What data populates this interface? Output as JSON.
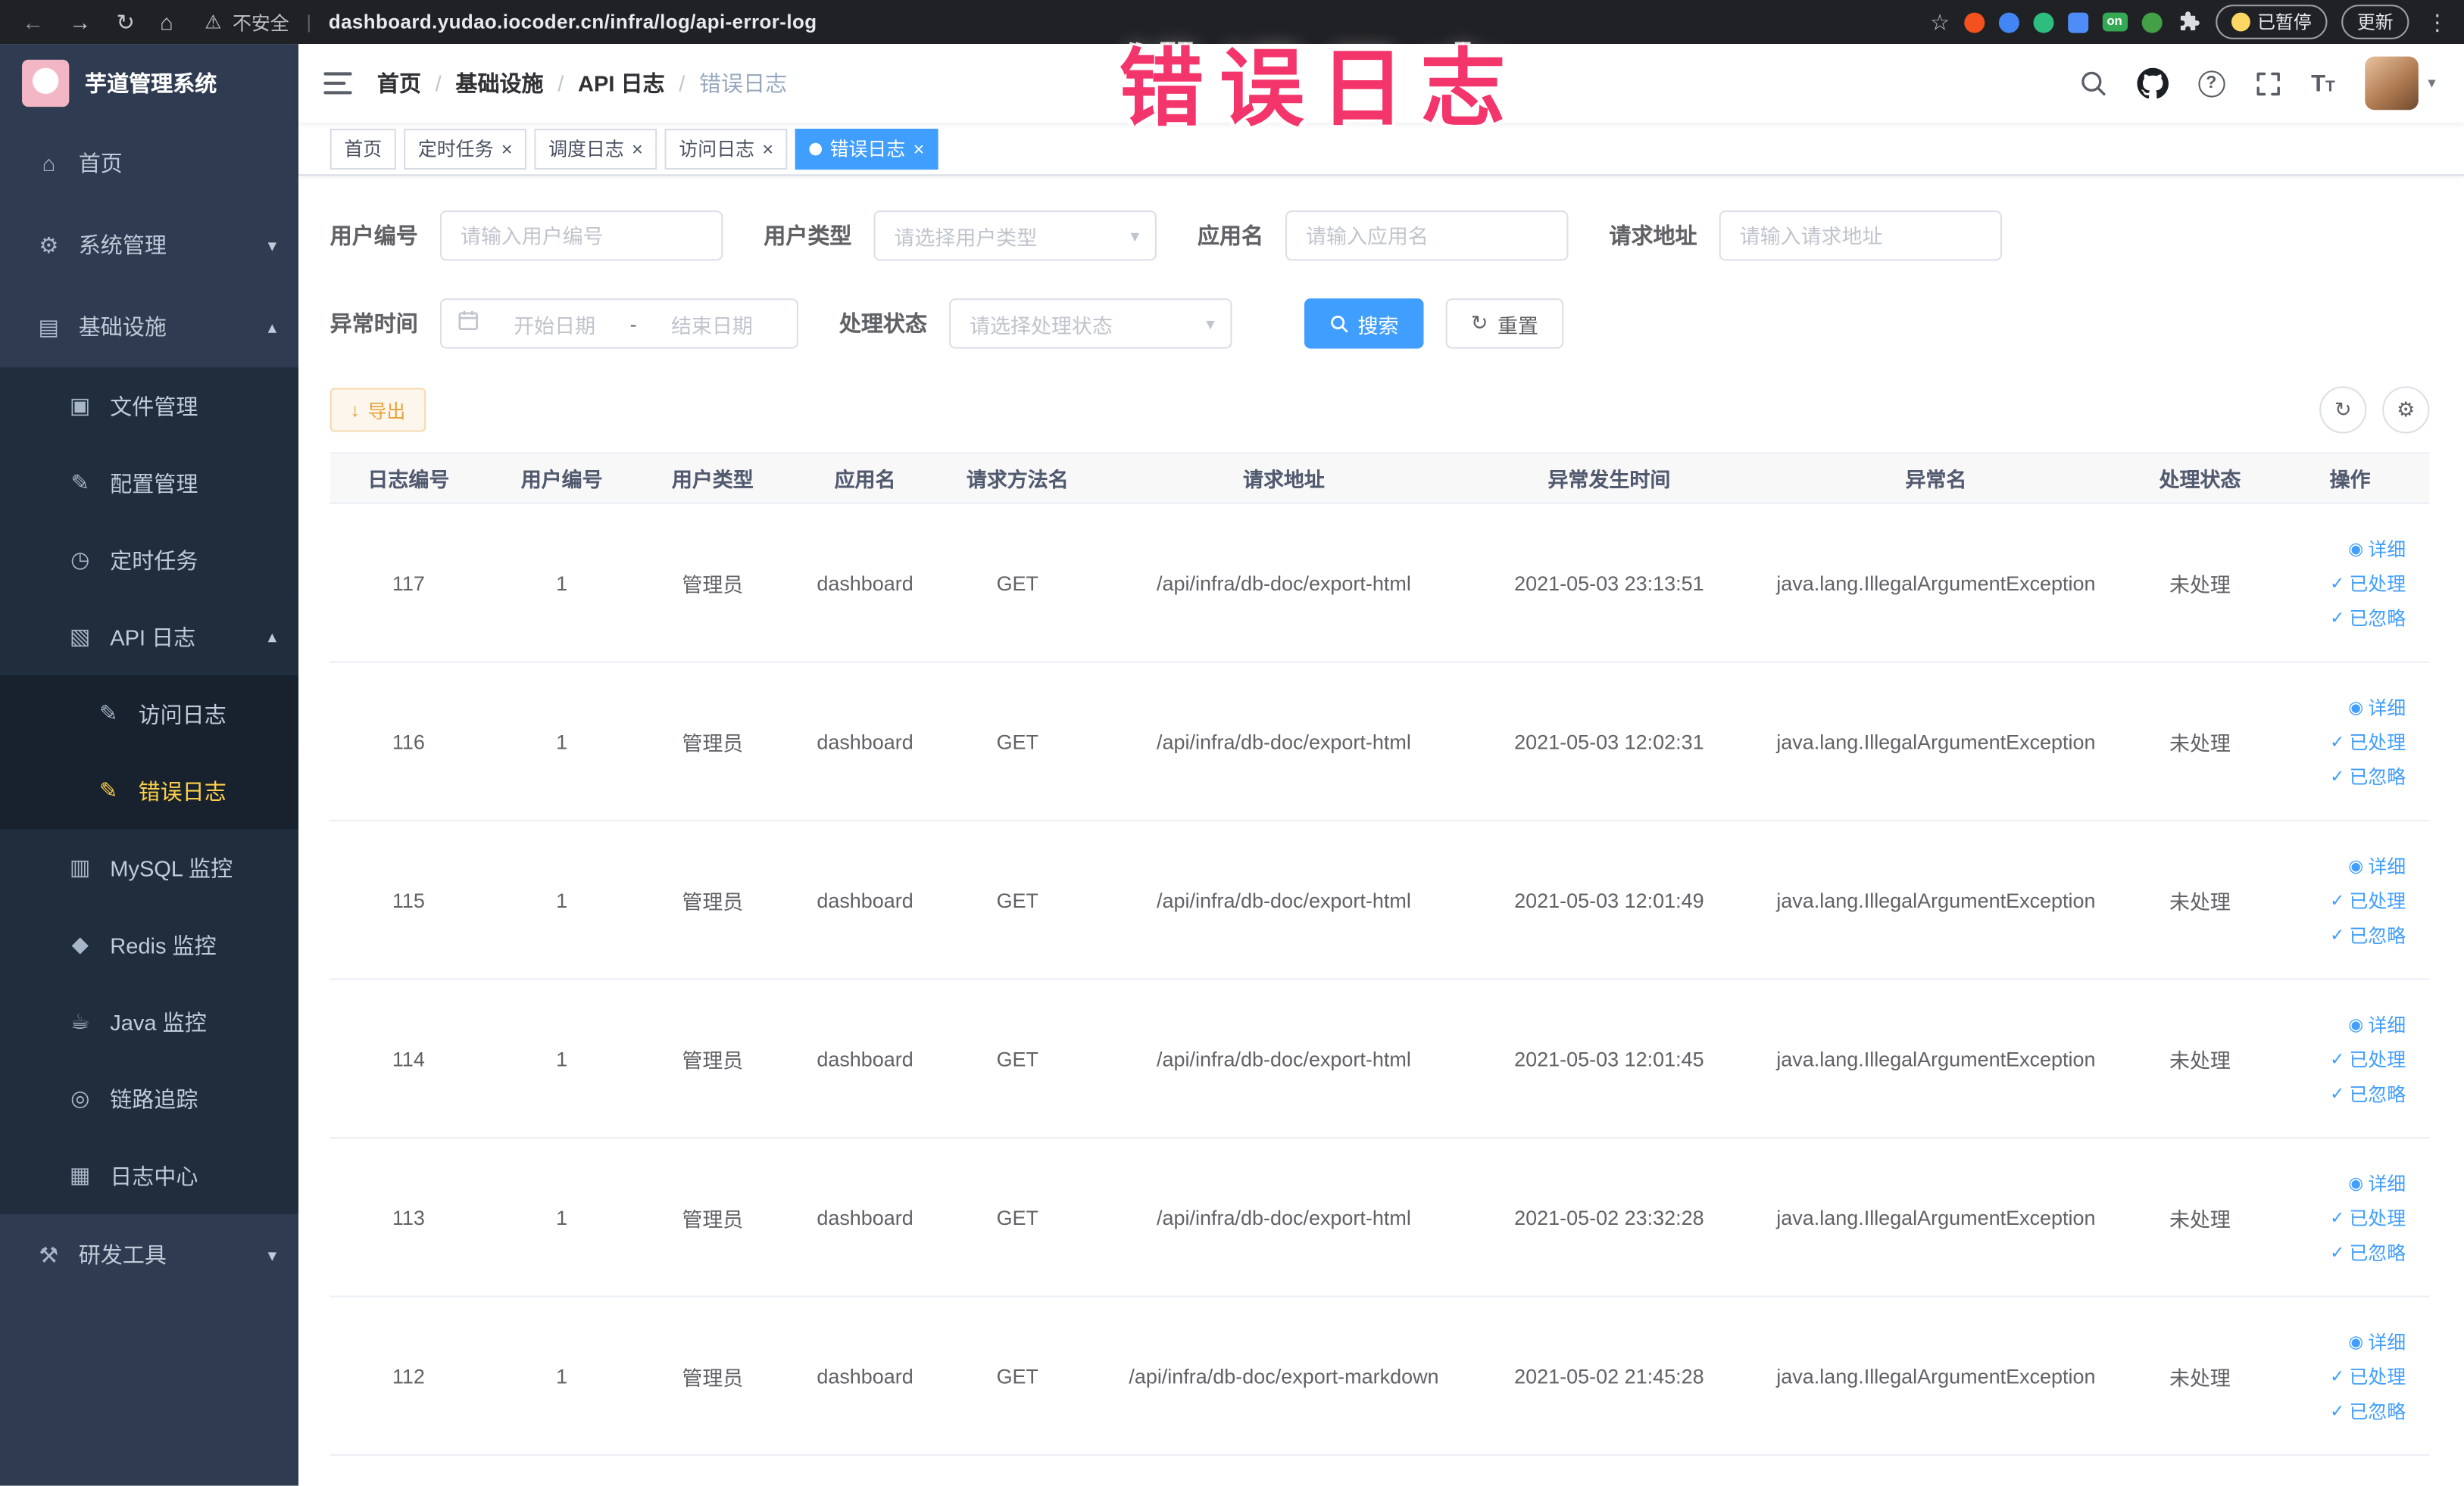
{
  "browser": {
    "security_label": "不安全",
    "url": "dashboard.yudao.iocoder.cn/infra/log/api-error-log",
    "ext_on_badge": "on",
    "paused_badge": "已暂停",
    "update_button": "更新"
  },
  "annotation": {
    "text": "错误日志"
  },
  "colors": {
    "accent": "#409eff",
    "sidebar_bg": "#2e3b50",
    "submenu_bg": "#1f2d3d",
    "menu_active_text": "#ffd04b",
    "warning_text": "#e6a23c",
    "annotation_text": "#f4356b"
  },
  "sidebar": {
    "logo_title": "芋道管理系统",
    "items": [
      {
        "label": "首页",
        "level": 1,
        "icon": "home-icon",
        "glyph": "⌂"
      },
      {
        "label": "系统管理",
        "level": 1,
        "icon": "gear-icon",
        "glyph": "⚙",
        "chevron": "down"
      },
      {
        "label": "基础设施",
        "level": 1,
        "icon": "infrastructure-icon",
        "glyph": "▤",
        "chevron": "up"
      },
      {
        "label": "文件管理",
        "level": 2,
        "icon": "file-icon",
        "glyph": "▣"
      },
      {
        "label": "配置管理",
        "level": 2,
        "icon": "config-icon",
        "glyph": "✎"
      },
      {
        "label": "定时任务",
        "level": 2,
        "icon": "schedule-icon",
        "glyph": "◷"
      },
      {
        "label": "API 日志",
        "level": 2,
        "icon": "api-log-icon",
        "glyph": "▧",
        "chevron": "up"
      },
      {
        "label": "访问日志",
        "level": 3,
        "icon": "access-log-icon",
        "glyph": "✎"
      },
      {
        "label": "错误日志",
        "level": 3,
        "icon": "error-log-icon",
        "glyph": "✎",
        "active": true
      },
      {
        "label": "MySQL 监控",
        "level": 2,
        "icon": "mysql-icon",
        "glyph": "▥"
      },
      {
        "label": "Redis 监控",
        "level": 2,
        "icon": "redis-icon",
        "glyph": "◆"
      },
      {
        "label": "Java 监控",
        "level": 2,
        "icon": "java-icon",
        "glyph": "☕"
      },
      {
        "label": "链路追踪",
        "level": 2,
        "icon": "trace-icon",
        "glyph": "◎"
      },
      {
        "label": "日志中心",
        "level": 2,
        "icon": "log-center-icon",
        "glyph": "▦"
      },
      {
        "label": "研发工具",
        "level": 1,
        "icon": "tools-icon",
        "glyph": "⚒",
        "chevron": "down"
      }
    ]
  },
  "header": {
    "breadcrumb": [
      "首页",
      "基础设施",
      "API 日志",
      "错误日志"
    ],
    "separator": "/"
  },
  "tabs": {
    "close_glyph": "×",
    "items": [
      {
        "label": "首页",
        "closable": false,
        "active": false
      },
      {
        "label": "定时任务",
        "closable": true,
        "active": false
      },
      {
        "label": "调度日志",
        "closable": true,
        "active": false
      },
      {
        "label": "访问日志",
        "closable": true,
        "active": false
      },
      {
        "label": "错误日志",
        "closable": true,
        "active": true
      }
    ]
  },
  "filters": {
    "user_id": {
      "label": "用户编号",
      "placeholder": "请输入用户编号"
    },
    "user_type": {
      "label": "用户类型",
      "placeholder": "请选择用户类型"
    },
    "app_name": {
      "label": "应用名",
      "placeholder": "请输入应用名"
    },
    "request_url": {
      "label": "请求地址",
      "placeholder": "请输入请求地址"
    },
    "exception_time": {
      "label": "异常时间",
      "start_placeholder": "开始日期",
      "end_placeholder": "结束日期",
      "separator": "-"
    },
    "process_status": {
      "label": "处理状态",
      "placeholder": "请选择处理状态"
    },
    "search_button": "搜索",
    "reset_button": "重置"
  },
  "toolbar": {
    "export_button": "导出"
  },
  "table": {
    "columns": [
      "日志编号",
      "用户编号",
      "用户类型",
      "应用名",
      "请求方法名",
      "请求地址",
      "异常发生时间",
      "异常名",
      "处理状态",
      "操作"
    ],
    "action_labels": [
      {
        "label": "详细",
        "icon": "eye"
      },
      {
        "label": "已处理",
        "icon": "check"
      },
      {
        "label": "已忽略",
        "icon": "check"
      }
    ],
    "rows": [
      {
        "id": "117",
        "user_id": "1",
        "user_type": "管理员",
        "app": "dashboard",
        "method": "GET",
        "url": "/api/infra/db-doc/export-html",
        "time": "2021-05-03 23:13:51",
        "exception": "java.lang.IllegalArgumentException",
        "status": "未处理"
      },
      {
        "id": "116",
        "user_id": "1",
        "user_type": "管理员",
        "app": "dashboard",
        "method": "GET",
        "url": "/api/infra/db-doc/export-html",
        "time": "2021-05-03 12:02:31",
        "exception": "java.lang.IllegalArgumentException",
        "status": "未处理"
      },
      {
        "id": "115",
        "user_id": "1",
        "user_type": "管理员",
        "app": "dashboard",
        "method": "GET",
        "url": "/api/infra/db-doc/export-html",
        "time": "2021-05-03 12:01:49",
        "exception": "java.lang.IllegalArgumentException",
        "status": "未处理"
      },
      {
        "id": "114",
        "user_id": "1",
        "user_type": "管理员",
        "app": "dashboard",
        "method": "GET",
        "url": "/api/infra/db-doc/export-html",
        "time": "2021-05-03 12:01:45",
        "exception": "java.lang.IllegalArgumentException",
        "status": "未处理"
      },
      {
        "id": "113",
        "user_id": "1",
        "user_type": "管理员",
        "app": "dashboard",
        "method": "GET",
        "url": "/api/infra/db-doc/export-html",
        "time": "2021-05-02 23:32:28",
        "exception": "java.lang.IllegalArgumentException",
        "status": "未处理"
      },
      {
        "id": "112",
        "user_id": "1",
        "user_type": "管理员",
        "app": "dashboard",
        "method": "GET",
        "url": "/api/infra/db-doc/export-markdown",
        "time": "2021-05-02 21:45:28",
        "exception": "java.lang.IllegalArgumentException",
        "status": "未处理"
      }
    ]
  },
  "glyphs": {
    "back": "←",
    "forward": "→",
    "reload": "↻",
    "home": "⌂",
    "warning": "⚠",
    "divider": "|",
    "star": "☆",
    "kebab": "⋮",
    "question": "?",
    "font_large": "T",
    "font_small": "T",
    "chev_down": "▾",
    "chev_up": "▴",
    "avatar_caret": "▾",
    "reset": "↻",
    "export": "↓",
    "refresh": "↻",
    "settings": "⚙",
    "eye": "◉",
    "check": "✓"
  }
}
